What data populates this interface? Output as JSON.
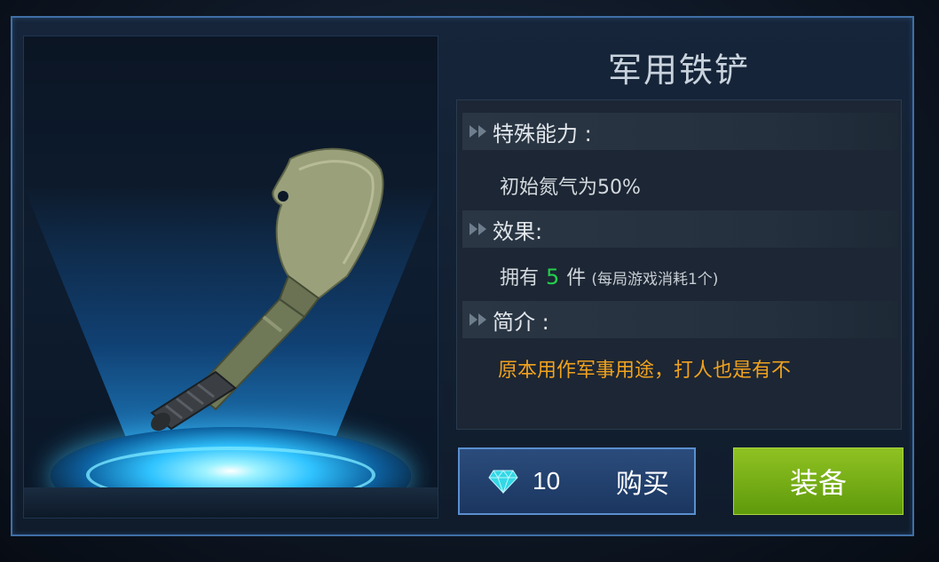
{
  "item": {
    "name": "军用铁铲",
    "image_icon": "shovel-icon"
  },
  "sections": [
    {
      "label": "特殊能力 :",
      "text": "初始氮气为50%"
    },
    {
      "label": "效果:",
      "owned_prefix": "拥有",
      "owned_count": "5",
      "owned_unit": "件",
      "owned_note": "(每局游戏消耗1个)"
    },
    {
      "label": "简介 :",
      "text": "原本用作军事用途，打人也是有不"
    }
  ],
  "buy": {
    "price": "10",
    "label": "购买",
    "currency_icon": "diamond-icon"
  },
  "equip": {
    "label": "装备"
  },
  "colors": {
    "accent_green": "#23d14a",
    "desc_orange": "#f0a21e",
    "equip_green": "#7ab31a",
    "buy_blue": "#2b4c7c"
  }
}
